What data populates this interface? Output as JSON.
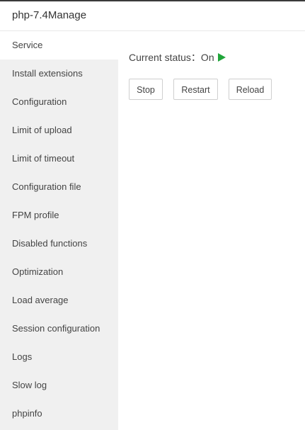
{
  "window": {
    "title": "php-7.4Manage"
  },
  "sidebar": {
    "items": [
      {
        "label": "Service",
        "active": true
      },
      {
        "label": "Install extensions"
      },
      {
        "label": "Configuration"
      },
      {
        "label": "Limit of upload"
      },
      {
        "label": "Limit of timeout"
      },
      {
        "label": "Configuration file"
      },
      {
        "label": "FPM profile"
      },
      {
        "label": "Disabled functions"
      },
      {
        "label": "Optimization"
      },
      {
        "label": "Load average"
      },
      {
        "label": "Session configuration"
      },
      {
        "label": "Logs"
      },
      {
        "label": "Slow log"
      },
      {
        "label": "phpinfo"
      }
    ]
  },
  "service": {
    "status_label": "Current status：On",
    "status_icon": "play-icon",
    "status_color": "#20a53a",
    "buttons": {
      "stop": "Stop",
      "restart": "Restart",
      "reload": "Reload"
    }
  }
}
